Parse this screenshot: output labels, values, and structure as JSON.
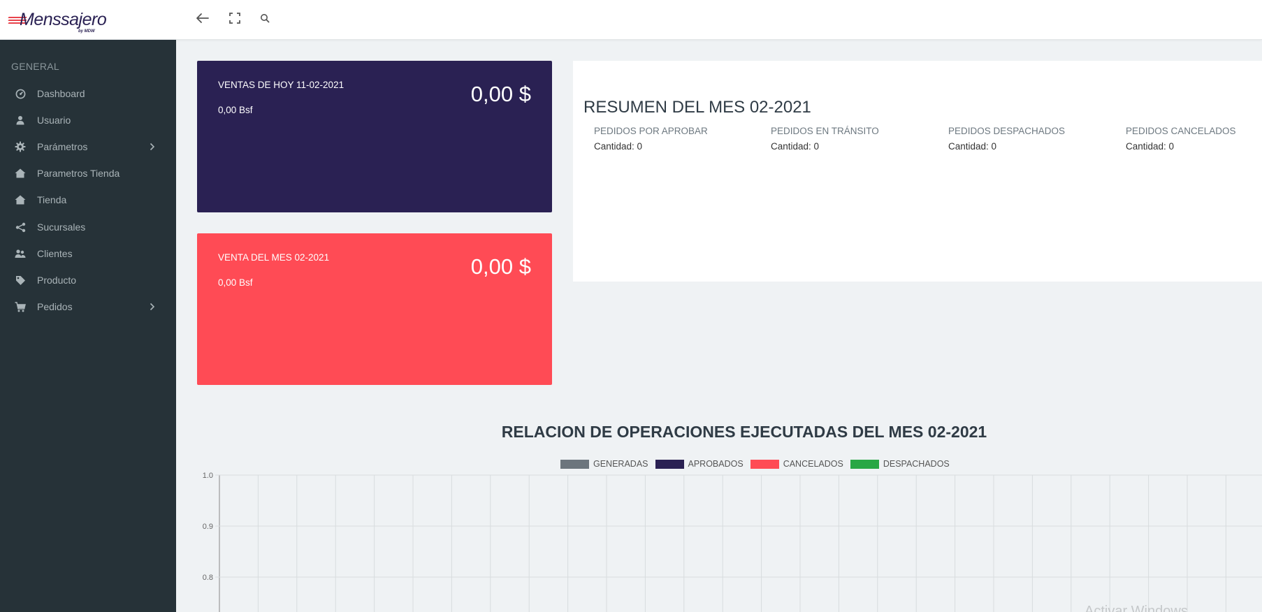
{
  "app": {
    "logo_text": "Menssajero",
    "logo_sub": "by MDW"
  },
  "header": {
    "icons": [
      "back-arrow-icon",
      "fullscreen-icon",
      "search-icon"
    ]
  },
  "sidebar": {
    "section": "GENERAL",
    "items": [
      {
        "label": "Dashboard",
        "icon": "dashboard-icon",
        "has_submenu": false
      },
      {
        "label": "Usuario",
        "icon": "user-icon",
        "has_submenu": false
      },
      {
        "label": "Parámetros",
        "icon": "gear-icon",
        "has_submenu": true
      },
      {
        "label": "Parametros Tienda",
        "icon": "home-icon",
        "has_submenu": false
      },
      {
        "label": "Tienda",
        "icon": "home-icon",
        "has_submenu": false
      },
      {
        "label": "Sucursales",
        "icon": "share-icon",
        "has_submenu": false
      },
      {
        "label": "Clientes",
        "icon": "users-icon",
        "has_submenu": false
      },
      {
        "label": "Producto",
        "icon": "tag-icon",
        "has_submenu": false
      },
      {
        "label": "Pedidos",
        "icon": "cart-icon",
        "has_submenu": true
      }
    ]
  },
  "cards": {
    "today": {
      "title": "VENTAS DE HOY 11-02-2021",
      "subtitle": "0,00 Bsf",
      "amount": "0,00 $",
      "color": "#2a2153"
    },
    "month": {
      "title": "VENTA DEL MES 02-2021",
      "subtitle": "0,00 Bsf",
      "amount": "0,00 $",
      "color": "#ff4b55"
    }
  },
  "summary": {
    "title": "RESUMEN DEL MES 02-2021",
    "columns": [
      {
        "label": "PEDIDOS POR APROBAR",
        "value": "Cantidad: 0"
      },
      {
        "label": "PEDIDOS EN TRÁNSITO",
        "value": "Cantidad: 0"
      },
      {
        "label": "PEDIDOS DESPACHADOS",
        "value": "Cantidad: 0"
      },
      {
        "label": "PEDIDOS CANCELADOS",
        "value": "Cantidad: 0"
      }
    ]
  },
  "chart_section": {
    "title": "RELACION DE OPERACIONES EJECUTADAS DEL MES 02-2021"
  },
  "chart_data": {
    "type": "bar",
    "title": "RELACION DE OPERACIONES EJECUTADAS DEL MES 02-2021",
    "series": [
      {
        "name": "GENERADAS",
        "color": "#6c757d",
        "values": []
      },
      {
        "name": "APROBADOS",
        "color": "#2a2153",
        "values": []
      },
      {
        "name": "CANCELADOS",
        "color": "#ff4b55",
        "values": []
      },
      {
        "name": "DESPACHADOS",
        "color": "#28a745",
        "values": []
      }
    ],
    "y_ticks": [
      "1.0",
      "0.9",
      "0.8"
    ],
    "ylim": [
      0.8,
      1.0
    ],
    "grid": true,
    "legend_position": "top"
  },
  "watermark": "Activar Windows"
}
